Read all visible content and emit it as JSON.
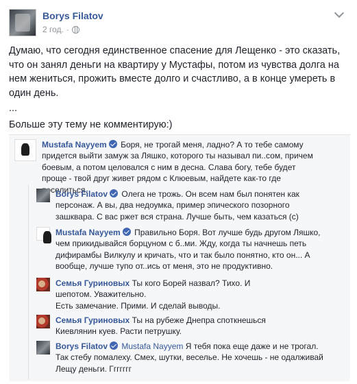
{
  "post": {
    "author": "Borys Filatov",
    "time": "2 год.",
    "separator": "·",
    "paragraphs": [
      "Думаю, что сегодня единственное спасение для Лещенко - это сказать, что он занял деньги на квартиру у Мустафы, потом из чувства долга на нем жениться, прожить вместе долго и счастливо, а в конце умереть в один день.",
      "...",
      "Больше эту тему не комментирую:)"
    ]
  },
  "comments": [
    {
      "author": "Mustafa Nayyem",
      "verified": true,
      "text": "Боря, не трогай меня, ладно? А то тебе самому придется выйти замуж за Ляшко, которого ты называл пи..сом, причем боевым, а потом целовался с ним в десна. Слава богу, тебе будет проще - твой друг живет рядом с Клюевым, найдете как-то где поселиться."
    },
    {
      "author": "Borys Filatov",
      "verified": true,
      "text": "Олега не трожь. Он всем нам был понятен как персонаж. А вы, два недоумка, пример эпического позорного зашквара. С вас ржет вся страна. Лучше быть, чем казаться (с)"
    },
    {
      "author": "Mustafa Nayyem",
      "verified": true,
      "text": "Правильно Боря. Вот лучше будь другом Ляшко, чем прикидывайся борцуном с б..ми. Жду, когда ты начнешь петь дифирамбы Вилкулу и кричать, что и так было понятно, кто он... А вообще, лучше тупо от..ись от меня, это не продуктивно."
    },
    {
      "author": "Семья Гуриновых",
      "verified": false,
      "text": "Ты кого Борей назвал? Тихо. И шепотом. Уважительно.",
      "text2": "Есть замечание. Прими. И сделай выводы."
    },
    {
      "author": "Семья Гуриновых",
      "verified": false,
      "text": "Ты на рубеже Днепра споткнешься Киевлянин куев. Расти петрушку."
    },
    {
      "author": "Borys Filatov",
      "verified": true,
      "mention": "Mustafa Nayyem",
      "text": "Я тебя пока еще даже и не трогал. Так стебу помалеху. Смех, шутки, веселье. Не хочешь - не одалживай Лещу деньги. Ггггггг"
    }
  ]
}
